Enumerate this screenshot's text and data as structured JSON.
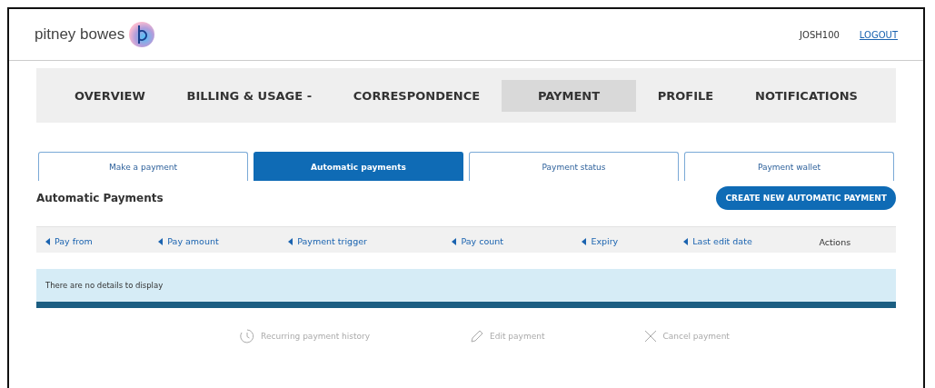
{
  "header": {
    "logo_text": "pitney bowes",
    "user": "JOSH100",
    "logout": "LOGOUT"
  },
  "nav": [
    {
      "label": "OVERVIEW",
      "selected": false
    },
    {
      "label": "BILLING & USAGE -",
      "selected": false
    },
    {
      "label": "CORRESPONDENCE",
      "selected": false
    },
    {
      "label": "PAYMENT",
      "selected": true
    },
    {
      "label": "PROFILE",
      "selected": false
    },
    {
      "label": "NOTIFICATIONS",
      "selected": false
    }
  ],
  "tabs": [
    {
      "label": "Make a payment",
      "selected": false
    },
    {
      "label": "Automatic payments",
      "selected": true
    },
    {
      "label": "Payment status",
      "selected": false
    },
    {
      "label": "Payment wallet",
      "selected": false
    }
  ],
  "section_title": "Automatic Payments",
  "create_button": "CREATE NEW AUTOMATIC PAYMENT",
  "table": {
    "columns": [
      {
        "label": "Pay from",
        "sortable": true
      },
      {
        "label": "Pay amount",
        "sortable": true
      },
      {
        "label": "Payment trigger",
        "sortable": true
      },
      {
        "label": "Pay count",
        "sortable": true
      },
      {
        "label": "Expiry",
        "sortable": true
      },
      {
        "label": "Last edit date",
        "sortable": true
      },
      {
        "label": "Actions",
        "sortable": false
      }
    ],
    "empty_message": "There are no details to display"
  },
  "actions": [
    {
      "label": "Recurring payment history",
      "kind": "history",
      "disabled": true
    },
    {
      "label": "Edit payment",
      "kind": "edit",
      "disabled": true
    },
    {
      "label": "Cancel payment",
      "kind": "cancel",
      "disabled": true
    }
  ]
}
